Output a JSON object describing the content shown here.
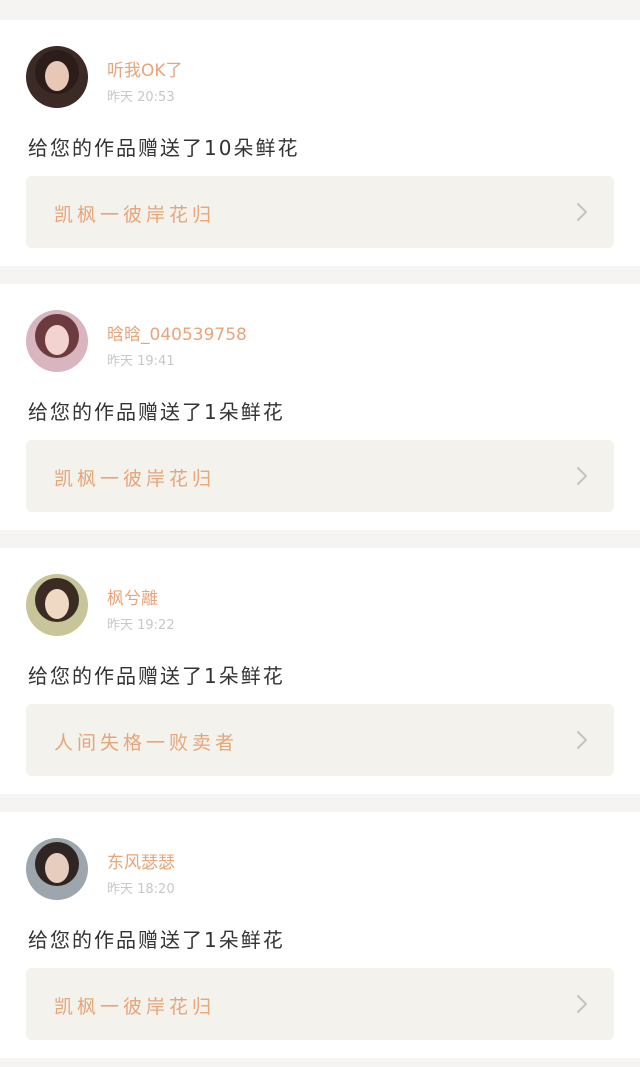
{
  "notifications": [
    {
      "username": "听我OK了",
      "time": "昨天 20:53",
      "message": "给您的作品赠送了10朵鲜花",
      "work_title": "凯枫一彼岸花归",
      "avatar": {
        "bg": "#3b2a26",
        "skin": "#e9c7b6",
        "hair": "#2a1d1a"
      }
    },
    {
      "username": "晗晗_040539758",
      "time": "昨天 19:41",
      "message": "给您的作品赠送了1朵鲜花",
      "work_title": "凯枫一彼岸花归",
      "avatar": {
        "bg": "#d9b6bf",
        "skin": "#f2d3cf",
        "hair": "#6b3b3f"
      }
    },
    {
      "username": "枫兮離",
      "time": "昨天 19:22",
      "message": "给您的作品赠送了1朵鲜花",
      "work_title": "人间失格一败卖者",
      "avatar": {
        "bg": "#c9c59a",
        "skin": "#efd8c4",
        "hair": "#3a2c22"
      }
    },
    {
      "username": "东风瑟瑟",
      "time": "昨天 18:20",
      "message": "给您的作品赠送了1朵鲜花",
      "work_title": "凯枫一彼岸花归",
      "avatar": {
        "bg": "#9ea6ad",
        "skin": "#e6cdbd",
        "hair": "#2f2522"
      }
    }
  ],
  "colors": {
    "accent": "#e8a57a",
    "timestamp": "#c8c8c8",
    "message": "#333333",
    "link_bg": "#f3f2ec",
    "page_bg": "#f6f3f3",
    "chevron": "#c4c4c4"
  },
  "icons": {
    "chevron": "chevron-right-icon"
  }
}
